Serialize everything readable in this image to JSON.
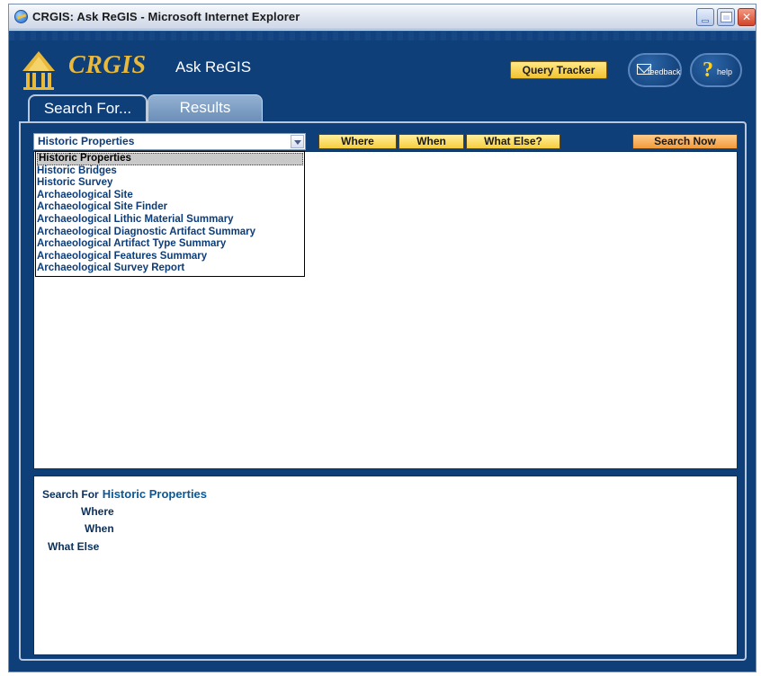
{
  "window": {
    "title": "CRGIS: Ask ReGIS - Microsoft Internet Explorer",
    "controls": [
      "minimize",
      "maximize",
      "close"
    ]
  },
  "header": {
    "logo_text": "CRGIS",
    "app_name": "Ask ReGIS",
    "query_tracker_label": "Query Tracker",
    "feedback_label": "feedback",
    "help_label": "help"
  },
  "tabs": [
    {
      "label": "Search For...",
      "active": true
    },
    {
      "label": "Results",
      "active": false
    }
  ],
  "search": {
    "selected_type": "Historic Properties",
    "options": [
      "Historic Properties",
      "Historic Bridges",
      "Historic Survey",
      "Archaeological Site",
      "Archaeological Site Finder",
      "Archaeological Lithic Material Summary",
      "Archaeological Diagnostic Artifact Summary",
      "Archaeological Artifact Type Summary",
      "Archaeological Features Summary",
      "Archaeological Survey Report"
    ],
    "where_label": "Where",
    "when_label": "When",
    "what_else_label": "What Else?",
    "search_now_label": "Search Now"
  },
  "summary": {
    "search_for_label": "Search For",
    "search_for_value": "Historic Properties",
    "where_label": "Where",
    "when_label": "When",
    "what_else_label": "What Else"
  },
  "colors": {
    "app_background": "#0f3f79",
    "accent_gold": "#f6cd3d",
    "search_now_orange": "#f29a3a",
    "text_navy": "#0c3d7a"
  },
  "icons": [
    "ie-icon",
    "crgis-logo-icon",
    "envelope-icon",
    "help-icon",
    "dropdown-arrow-icon"
  ]
}
